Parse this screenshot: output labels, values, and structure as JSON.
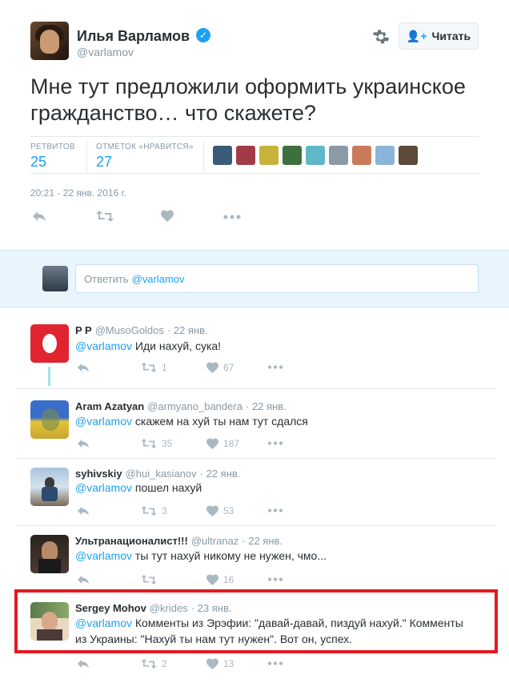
{
  "header": {
    "display_name": "Илья Варламов",
    "handle": "@varlamov",
    "follow_label": "Читать"
  },
  "tweet": {
    "text": "Мне тут предложили оформить украинское гражданство… что скажете?",
    "retweets_label": "РЕТВИТОВ",
    "retweets": "25",
    "likes_label": "ОТМЕТОК «НРАВИТСЯ»",
    "likes": "27",
    "date": "20:21 - 22 янв. 2016 г."
  },
  "reply_box": {
    "prefix": "Ответить",
    "mention": "@varlamov"
  },
  "replies": [
    {
      "name": "P P",
      "handle": "@MusoGoldos",
      "date": "· 22 янв.",
      "mention": "@varlamov",
      "text": " Иди нахуй, сука!",
      "retweets": "1",
      "likes": "67"
    },
    {
      "name": "Aram Azatyan",
      "handle": "@armyano_bandera",
      "date": "· 22 янв.",
      "mention": "@varlamov",
      "text": " скажем на хуй ты нам тут сдался",
      "retweets": "35",
      "likes": "187"
    },
    {
      "name": "syhivskiy",
      "handle": "@hui_kasianov",
      "date": "· 22 янв.",
      "mention": "@varlamov",
      "text": " пошел нахуй",
      "retweets": "3",
      "likes": "53"
    },
    {
      "name": "Ультранационалист!!!",
      "handle": "@ultranaz",
      "date": "· 22 янв.",
      "mention": "@varlamov",
      "text": " ты тут нахуй никому не нужен, чмо...",
      "retweets": "",
      "likes": "16"
    },
    {
      "name": "Sergey Mohov",
      "handle": "@krides",
      "date": "· 23 янв.",
      "mention": "@varlamov",
      "text": " Комменты из Эрэфии: \"давай-давай, пиздуй нахуй.\" Комменты",
      "text2": "из Украины: \"Нахуй ты нам тут нужен\". Вот он, успех.",
      "retweets": "2",
      "likes": "13"
    }
  ],
  "colors": {
    "accent": "#1da1f2",
    "highlight_border": "#e21a22",
    "reply_band": "#e8f5fd"
  },
  "icons": [
    "verified-icon",
    "gear-icon",
    "follow-icon",
    "reply-icon",
    "retweet-icon",
    "like-icon",
    "more-icon"
  ]
}
